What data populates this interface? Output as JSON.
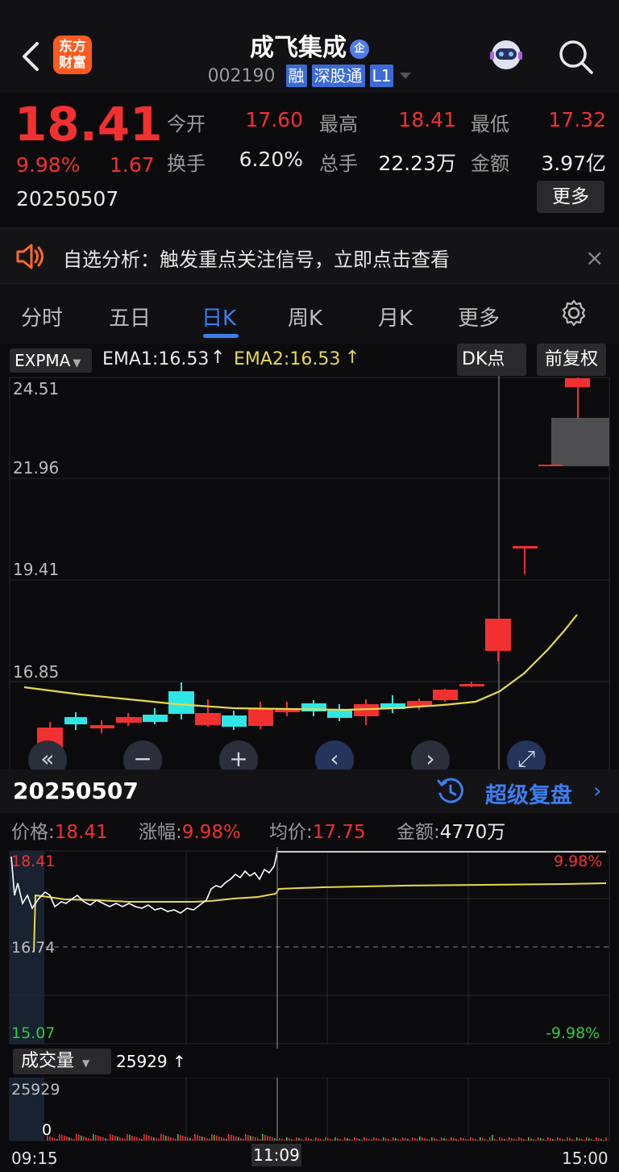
{
  "header": {
    "back_icon": "chevron-left-icon",
    "logo_line1": "东方",
    "logo_line2": "财富",
    "stock_name": "成飞集成",
    "enterprise_badge": "企",
    "stock_code": "002190",
    "tags": [
      "融",
      "深股通",
      "L1"
    ],
    "robot_icon": "robot-assistant-icon",
    "search_icon": "search-icon"
  },
  "quote": {
    "price": "18.41",
    "change_pct": "9.98%",
    "change_amt": "1.67",
    "date": "20250507",
    "fields": [
      {
        "label": "今开",
        "value": "17.60",
        "color": "red"
      },
      {
        "label": "最高",
        "value": "18.41",
        "color": "red"
      },
      {
        "label": "最低",
        "value": "17.32",
        "color": "red"
      },
      {
        "label": "换手",
        "value": "6.20%",
        "color": "white"
      },
      {
        "label": "总手",
        "value": "22.23万",
        "color": "white"
      },
      {
        "label": "金额",
        "value": "3.97亿",
        "color": "white"
      }
    ],
    "more_label": "更多"
  },
  "notice": {
    "text": "自选分析：触发重点关注信号，立即点击查看",
    "close": "×"
  },
  "tabs": [
    "分时",
    "五日",
    "日K",
    "周K",
    "月K",
    "更多"
  ],
  "active_tab": "日K",
  "indicator": {
    "name": "EXPMA",
    "ema1": "EMA1:16.53",
    "ema2": "EMA2:16.53",
    "dk_label": "DK点",
    "adjust_label": "前复权"
  },
  "kline": {
    "y_labels": [
      "24.51",
      "21.96",
      "19.41",
      "16.85"
    ],
    "ema_color": "#e8d84a",
    "up_color": "#f23030",
    "down_color": "#2ee6e6",
    "controls": [
      "«",
      "−",
      "+",
      "‹",
      "›",
      "⤢"
    ]
  },
  "replay": {
    "date": "20250507",
    "link_label": "超级复盘",
    "arrow": "›"
  },
  "info": [
    {
      "label": "价格:",
      "value": "18.41",
      "color": "red"
    },
    {
      "label": "涨幅:",
      "value": "9.98%",
      "color": "red"
    },
    {
      "label": "均价:",
      "value": "17.75",
      "color": "red"
    },
    {
      "label": "金额:",
      "value": "4770万",
      "color": "white"
    }
  ],
  "intraday": {
    "top_price": "18.41",
    "mid_price": "16.74",
    "bottom_price": "15.07",
    "top_pct": "9.98%",
    "bottom_pct": "-9.98%"
  },
  "volume": {
    "selector": "成交量",
    "value": "25929 ↑",
    "max_label": "25929",
    "zero_label": "0"
  },
  "time_axis": {
    "start": "09:15",
    "cursor": "11:09",
    "end": "15:00"
  }
}
